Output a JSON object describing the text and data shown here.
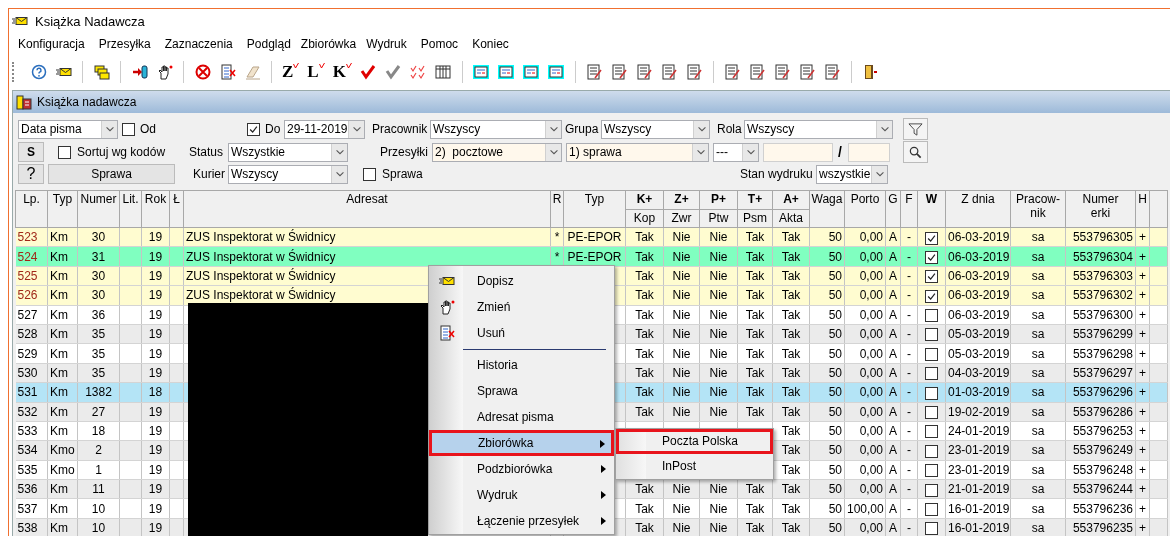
{
  "window": {
    "title": "Książka Nadawcza"
  },
  "menu": [
    "Konfiguracja",
    "Przesyłka",
    "Zaznaczenia",
    "Podgląd",
    "Zbiorówka",
    "Wydruk",
    "Pomoc",
    "Koniec"
  ],
  "toolbar": [
    {
      "kind": "help"
    },
    {
      "kind": "envelope"
    },
    {
      "kind": "sep"
    },
    {
      "kind": "papers"
    },
    {
      "kind": "sep"
    },
    {
      "kind": "login"
    },
    {
      "kind": "hand"
    },
    {
      "kind": "sep"
    },
    {
      "kind": "forbidden"
    },
    {
      "kind": "list-delete"
    },
    {
      "kind": "eraser"
    },
    {
      "kind": "sep"
    },
    {
      "kind": "letter",
      "text": "Z"
    },
    {
      "kind": "letter",
      "text": "L"
    },
    {
      "kind": "letter",
      "text": "K"
    },
    {
      "kind": "check-red"
    },
    {
      "kind": "check-grey"
    },
    {
      "kind": "checks"
    },
    {
      "kind": "grid"
    },
    {
      "kind": "sep"
    },
    {
      "kind": "form"
    },
    {
      "kind": "form"
    },
    {
      "kind": "form"
    },
    {
      "kind": "form"
    },
    {
      "kind": "sep"
    },
    {
      "kind": "document"
    },
    {
      "kind": "document"
    },
    {
      "kind": "document"
    },
    {
      "kind": "document"
    },
    {
      "kind": "document"
    },
    {
      "kind": "sep"
    },
    {
      "kind": "document"
    },
    {
      "kind": "document"
    },
    {
      "kind": "document"
    },
    {
      "kind": "document"
    },
    {
      "kind": "document"
    },
    {
      "kind": "sep"
    },
    {
      "kind": "exit"
    }
  ],
  "child_window": {
    "title": "Książka nadawcza"
  },
  "filters": {
    "date_type": {
      "value": "Data pisma"
    },
    "from": {
      "label": "Od",
      "checked": false
    },
    "to": {
      "label": "Do",
      "checked": true,
      "value": "29-11-2019"
    },
    "employee": {
      "label": "Pracownik",
      "value": "Wszyscy"
    },
    "group": {
      "label": "Grupa",
      "value": "Wszyscy"
    },
    "role": {
      "label": "Rola",
      "value": "Wszyscy"
    },
    "s_button": "S",
    "sort_by_codes": {
      "label": "Sortuj wg kodów",
      "checked": false
    },
    "status": {
      "label": "Status",
      "value": "Wszystkie"
    },
    "shipments": {
      "label": "Przesyłki",
      "value": "2)  pocztowe"
    },
    "case_type": {
      "value": "1) sprawa"
    },
    "range_type": {
      "value": "---"
    },
    "slash": "/",
    "help_button": "?",
    "case_button": "Sprawa",
    "courier": {
      "label": "Kurier",
      "value": "Wszyscy"
    },
    "case_check": {
      "label": "Sprawa",
      "checked": false
    },
    "print_state": {
      "label": "Stan wydruku",
      "value": "wszystkie"
    }
  },
  "table": {
    "redacted": true,
    "columns": [
      {
        "label": "Lp."
      },
      {
        "label": "Typ"
      },
      {
        "label": "Numer"
      },
      {
        "label": "Lit."
      },
      {
        "label": "Rok"
      },
      {
        "label": "Ł"
      },
      {
        "label": "Adresat"
      },
      {
        "label": "R"
      },
      {
        "label": "Typ"
      },
      {
        "label": "K+",
        "sub": "Kop"
      },
      {
        "label": "Z+",
        "sub": "Zwr"
      },
      {
        "label": "P+",
        "sub": "Ptw"
      },
      {
        "label": "T+",
        "sub": "Psm"
      },
      {
        "label": "A+",
        "sub": "Akta"
      },
      {
        "label": "Waga"
      },
      {
        "label": "Porto"
      },
      {
        "label": "G"
      },
      {
        "label": "F"
      },
      {
        "label": "W",
        "bold": true
      },
      {
        "label": "Z dnia"
      },
      {
        "label": "Pracow-\nnik"
      },
      {
        "label": "Numer\nerki"
      },
      {
        "label": "H"
      }
    ],
    "rows": [
      {
        "lp": "523",
        "typ": "Km",
        "numer": "30",
        "rok": "19",
        "adresat": "ZUS Inspektorat w Świdnicy",
        "r": "*",
        "typ2": "PE-EPOR",
        "flags": [
          "Tak",
          "Nie",
          "Nie",
          "Tak",
          "Tak"
        ],
        "waga": "50",
        "porto": "0,00",
        "g": "A",
        "f": "-",
        "checked": true,
        "date": "06-03-2019",
        "worker": "sa",
        "tracking": "553796305",
        "h": "+",
        "color": "#fffcd0",
        "marked": true
      },
      {
        "lp": "524",
        "typ": "Km",
        "numer": "31",
        "rok": "19",
        "adresat": "ZUS Inspektorat w Świdnicy",
        "r": "*",
        "typ2": "PE-EPOR",
        "flags": [
          "Tak",
          "Nie",
          "Nie",
          "Tak",
          "Tak"
        ],
        "waga": "50",
        "porto": "0,00",
        "g": "A",
        "f": "-",
        "checked": true,
        "date": "06-03-2019",
        "worker": "sa",
        "tracking": "553796304",
        "h": "+",
        "color": "#80ffc0",
        "marked": true
      },
      {
        "lp": "525",
        "typ": "Km",
        "numer": "30",
        "rok": "19",
        "adresat": "ZUS Inspektorat w Świdnicy",
        "flags": [
          "Tak",
          "Nie",
          "Nie",
          "Tak",
          "Tak"
        ],
        "waga": "50",
        "porto": "0,00",
        "g": "A",
        "f": "-",
        "checked": true,
        "date": "06-03-2019",
        "worker": "sa",
        "tracking": "553796303",
        "h": "+",
        "color": "#fffcd0",
        "marked": true
      },
      {
        "lp": "526",
        "typ": "Km",
        "numer": "30",
        "rok": "19",
        "adresat": "ZUS Inspektorat w Świdnicy",
        "flags": [
          "Tak",
          "Nie",
          "Nie",
          "Tak",
          "Tak"
        ],
        "waga": "50",
        "porto": "0,00",
        "g": "A",
        "f": "-",
        "checked": true,
        "date": "06-03-2019",
        "worker": "sa",
        "tracking": "553796302",
        "h": "+",
        "color": "#fffcd0",
        "marked": true
      },
      {
        "lp": "527",
        "typ": "Km",
        "numer": "36",
        "rok": "19",
        "flags": [
          "Tak",
          "Nie",
          "Nie",
          "Tak",
          "Tak"
        ],
        "waga": "50",
        "porto": "0,00",
        "g": "A",
        "f": "-",
        "checked": false,
        "date": "06-03-2019",
        "worker": "sa",
        "tracking": "553796300",
        "h": "+",
        "color": "#ffffff",
        "marked": false
      },
      {
        "lp": "528",
        "typ": "Km",
        "numer": "35",
        "rok": "19",
        "flags": [
          "Tak",
          "Nie",
          "Nie",
          "Tak",
          "Tak"
        ],
        "waga": "50",
        "porto": "0,00",
        "g": "A",
        "f": "-",
        "checked": false,
        "date": "05-03-2019",
        "worker": "sa",
        "tracking": "553796299",
        "h": "+",
        "color": "#ebebeb",
        "marked": false
      },
      {
        "lp": "529",
        "typ": "Km",
        "numer": "35",
        "rok": "19",
        "flags": [
          "Tak",
          "Nie",
          "Nie",
          "Tak",
          "Tak"
        ],
        "waga": "50",
        "porto": "0,00",
        "g": "A",
        "f": "-",
        "checked": false,
        "date": "05-03-2019",
        "worker": "sa",
        "tracking": "553796298",
        "h": "+",
        "color": "#ffffff",
        "marked": false
      },
      {
        "lp": "530",
        "typ": "Km",
        "numer": "35",
        "rok": "19",
        "flags": [
          "Tak",
          "Nie",
          "Nie",
          "Tak",
          "Tak"
        ],
        "waga": "50",
        "porto": "0,00",
        "g": "A",
        "f": "-",
        "checked": false,
        "date": "04-03-2019",
        "worker": "sa",
        "tracking": "553796297",
        "h": "+",
        "color": "#ebebeb",
        "marked": false
      },
      {
        "lp": "531",
        "typ": "Km",
        "numer": "1382",
        "rok": "18",
        "flags": [
          "Tak",
          "Nie",
          "Nie",
          "Tak",
          "Tak"
        ],
        "waga": "50",
        "porto": "0,00",
        "g": "A",
        "f": "-",
        "checked": false,
        "date": "01-03-2019",
        "worker": "sa",
        "tracking": "553796296",
        "h": "+",
        "color": "#b4e4f6",
        "marked": false
      },
      {
        "lp": "532",
        "typ": "Km",
        "numer": "27",
        "rok": "19",
        "flags": [
          "Tak",
          "Nie",
          "Nie",
          "Tak",
          "Tak"
        ],
        "waga": "50",
        "porto": "0,00",
        "g": "A",
        "f": "-",
        "checked": false,
        "date": "19-02-2019",
        "worker": "sa",
        "tracking": "553796286",
        "h": "+",
        "color": "#ebebeb",
        "marked": false
      },
      {
        "lp": "533",
        "typ": "Km",
        "numer": "18",
        "rok": "19",
        "akta": "Tak",
        "waga": "50",
        "porto": "0,00",
        "g": "A",
        "f": "-",
        "checked": false,
        "date": "24-01-2019",
        "worker": "sa",
        "tracking": "553796253",
        "h": "+",
        "color": "#ffffff",
        "marked": false
      },
      {
        "lp": "534",
        "typ": "Kmo",
        "numer": "2",
        "rok": "19",
        "akta": "Tak",
        "waga": "50",
        "porto": "0,00",
        "g": "A",
        "f": "-",
        "checked": false,
        "date": "23-01-2019",
        "worker": "sa",
        "tracking": "553796249",
        "h": "+",
        "color": "#ebebeb",
        "marked": false
      },
      {
        "lp": "535",
        "typ": "Kmo",
        "numer": "1",
        "rok": "19",
        "akta": "Tak",
        "waga": "50",
        "porto": "0,00",
        "g": "A",
        "f": "-",
        "checked": false,
        "date": "23-01-2019",
        "worker": "sa",
        "tracking": "553796248",
        "h": "+",
        "color": "#ffffff",
        "marked": false
      },
      {
        "lp": "536",
        "typ": "Km",
        "numer": "11",
        "rok": "19",
        "flags": [
          "Tak",
          "Nie",
          "Nie",
          "Tak",
          "Tak"
        ],
        "waga": "50",
        "porto": "0,00",
        "g": "A",
        "f": "-",
        "checked": false,
        "date": "21-01-2019",
        "worker": "sa",
        "tracking": "553796244",
        "h": "+",
        "color": "#ebebeb",
        "marked": false
      },
      {
        "lp": "537",
        "typ": "Km",
        "numer": "10",
        "rok": "19",
        "flags": [
          "Tak",
          "Nie",
          "Nie",
          "Tak",
          "Tak"
        ],
        "waga": "50",
        "porto": "100,00",
        "g": "A",
        "f": "-",
        "checked": false,
        "date": "16-01-2019",
        "worker": "sa",
        "tracking": "553796236",
        "h": "+",
        "color": "#ffffff",
        "marked": false
      },
      {
        "lp": "538",
        "typ": "Km",
        "numer": "10",
        "rok": "19",
        "flags": [
          "Tak",
          "Nie",
          "Nie",
          "Tak",
          "Tak"
        ],
        "waga": "50",
        "porto": "0,00",
        "g": "A",
        "f": "-",
        "checked": false,
        "date": "16-01-2019",
        "worker": "sa",
        "tracking": "553796235",
        "h": "+",
        "color": "#ebebeb",
        "marked": false
      }
    ]
  },
  "context_menu": {
    "items": [
      {
        "kind": "item",
        "label": "Dopisz",
        "selected": false,
        "highlighted": false,
        "submenu": false
      },
      {
        "kind": "item",
        "label": "Zmień",
        "selected": false,
        "highlighted": false,
        "submenu": false
      },
      {
        "kind": "item",
        "label": "Usuń",
        "selected": false,
        "highlighted": false,
        "submenu": false
      },
      {
        "kind": "separator"
      },
      {
        "kind": "item",
        "label": "Historia",
        "selected": false,
        "highlighted": false,
        "submenu": false
      },
      {
        "kind": "item",
        "label": "Sprawa",
        "selected": false,
        "highlighted": false,
        "submenu": false
      },
      {
        "kind": "item",
        "label": "Adresat pisma",
        "selected": false,
        "highlighted": false,
        "submenu": false
      },
      {
        "kind": "item",
        "label": "Zbiorówka",
        "selected": true,
        "highlighted": true,
        "submenu": true
      },
      {
        "kind": "item",
        "label": "Podzbiorówka",
        "selected": false,
        "highlighted": false,
        "submenu": true
      },
      {
        "kind": "item",
        "label": "Wydruk",
        "selected": false,
        "highlighted": false,
        "submenu": true
      },
      {
        "kind": "item",
        "label": "Łączenie przesyłek",
        "selected": false,
        "highlighted": false,
        "submenu": true
      }
    ],
    "submenu": [
      {
        "label": "Poczta Polska",
        "highlighted": true
      },
      {
        "label": "InPost",
        "highlighted": false
      }
    ]
  }
}
